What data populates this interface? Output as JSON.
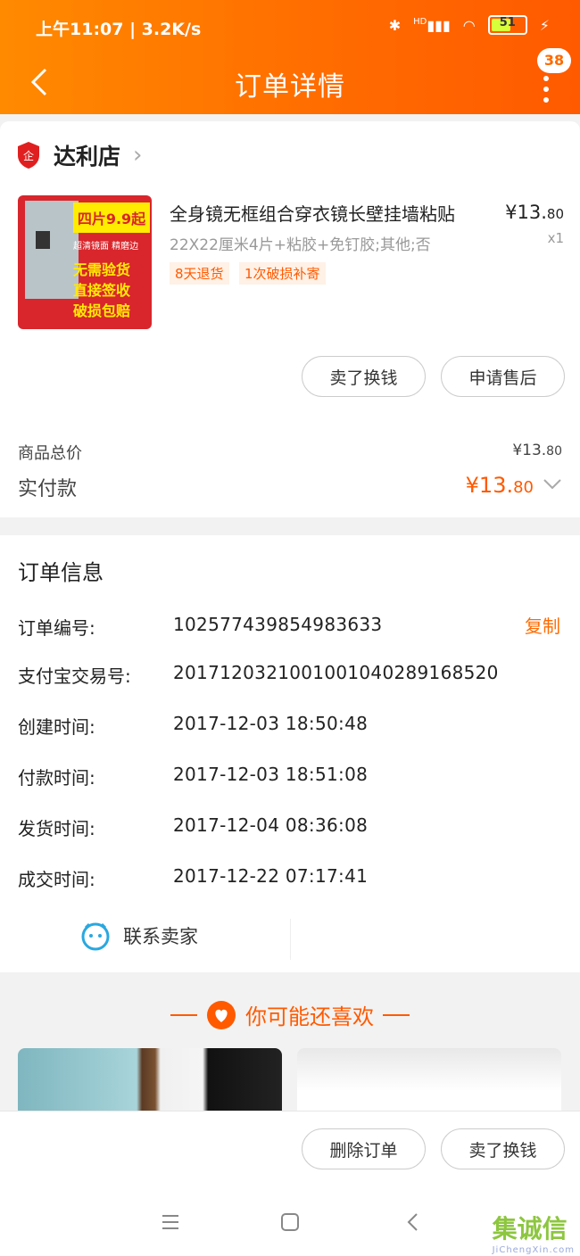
{
  "status_bar": {
    "left": "上午11:07 | 3.2K/s",
    "battery": "51",
    "network": "HD"
  },
  "header": {
    "title": "订单详情",
    "badge": "38"
  },
  "store": {
    "name": "达利店"
  },
  "product": {
    "title": "全身镜无框组合穿衣镜长壁挂墙粘贴",
    "spec": "22X22厘米4片+粘胶+免钉胶;其他;否",
    "tags": [
      "8天退货",
      "1次破损补寄"
    ],
    "price_int": "¥13.",
    "price_dec": "80",
    "qty": "x1",
    "thumb_text": {
      "headline": "四片9.9起",
      "sub": "超清镜面 精磨边",
      "line1": "无需验货",
      "line2": "直接签收",
      "line3": "破损包赔"
    }
  },
  "item_actions": {
    "sell": "卖了换钱",
    "after_sale": "申请售后"
  },
  "summary": {
    "total_label": "商品总价",
    "total_int": "¥13.",
    "total_dec": "80",
    "paid_label": "实付款",
    "paid_int": "¥13.",
    "paid_dec": "80"
  },
  "order_info": {
    "title": "订单信息",
    "copy": "复制",
    "rows": [
      {
        "label": "订单编号:",
        "value": "102577439854983633"
      },
      {
        "label": "支付宝交易号:",
        "value": "2017120321001001040289168520"
      },
      {
        "label": "创建时间:",
        "value": "2017-12-03 18:50:48"
      },
      {
        "label": "付款时间:",
        "value": "2017-12-03 18:51:08"
      },
      {
        "label": "发货时间:",
        "value": "2017-12-04 08:36:08"
      },
      {
        "label": "成交时间:",
        "value": "2017-12-22 07:17:41"
      }
    ],
    "contact": "联系卖家"
  },
  "recommend": {
    "title": "你可能还喜欢"
  },
  "bottom_actions": {
    "delete": "删除订单",
    "sell": "卖了换钱"
  },
  "watermark": {
    "brand": "集诚信",
    "site": "JiChengXin.com"
  },
  "colors": {
    "accent": "#ff6a00",
    "price": "#ff5a00"
  }
}
